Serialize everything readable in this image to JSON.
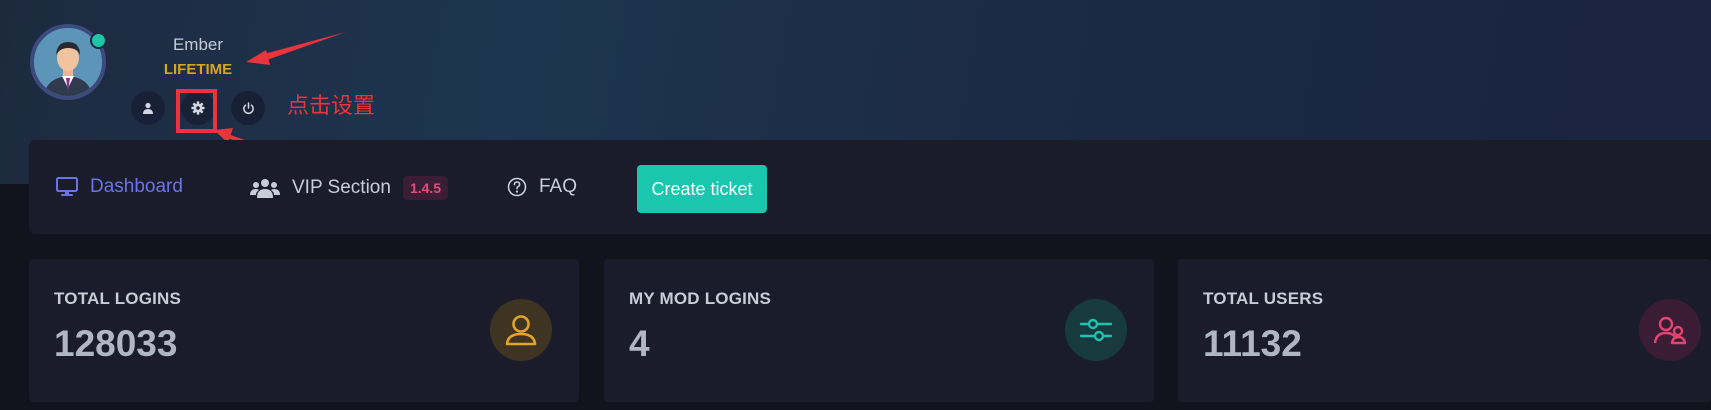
{
  "user": {
    "name": "Ember",
    "plan": "LIFETIME"
  },
  "header_actions": [
    {
      "icon": "user-icon"
    },
    {
      "icon": "gear-icon"
    },
    {
      "icon": "power-icon"
    }
  ],
  "annotation": {
    "text": "点击设置",
    "color": "#e8343a"
  },
  "nav": {
    "dashboard": "Dashboard",
    "vip": "VIP Section",
    "vip_badge": "1.4.5",
    "faq": "FAQ",
    "create_ticket": "Create ticket"
  },
  "stats": [
    {
      "label": "TOTAL LOGINS",
      "value": "128033",
      "icon": "user-icon",
      "color": "#e0a42a"
    },
    {
      "label": "MY MOD LOGINS",
      "value": "4",
      "icon": "sliders-icon",
      "color": "#1fc1b1"
    },
    {
      "label": "TOTAL USERS",
      "value": "11132",
      "icon": "users-icon",
      "color": "#e2456f"
    }
  ],
  "colors": {
    "accent": "#1bc6ae",
    "active_nav": "#6b73e6",
    "plan": "#d6a51b",
    "online": "#1cc6a7"
  }
}
